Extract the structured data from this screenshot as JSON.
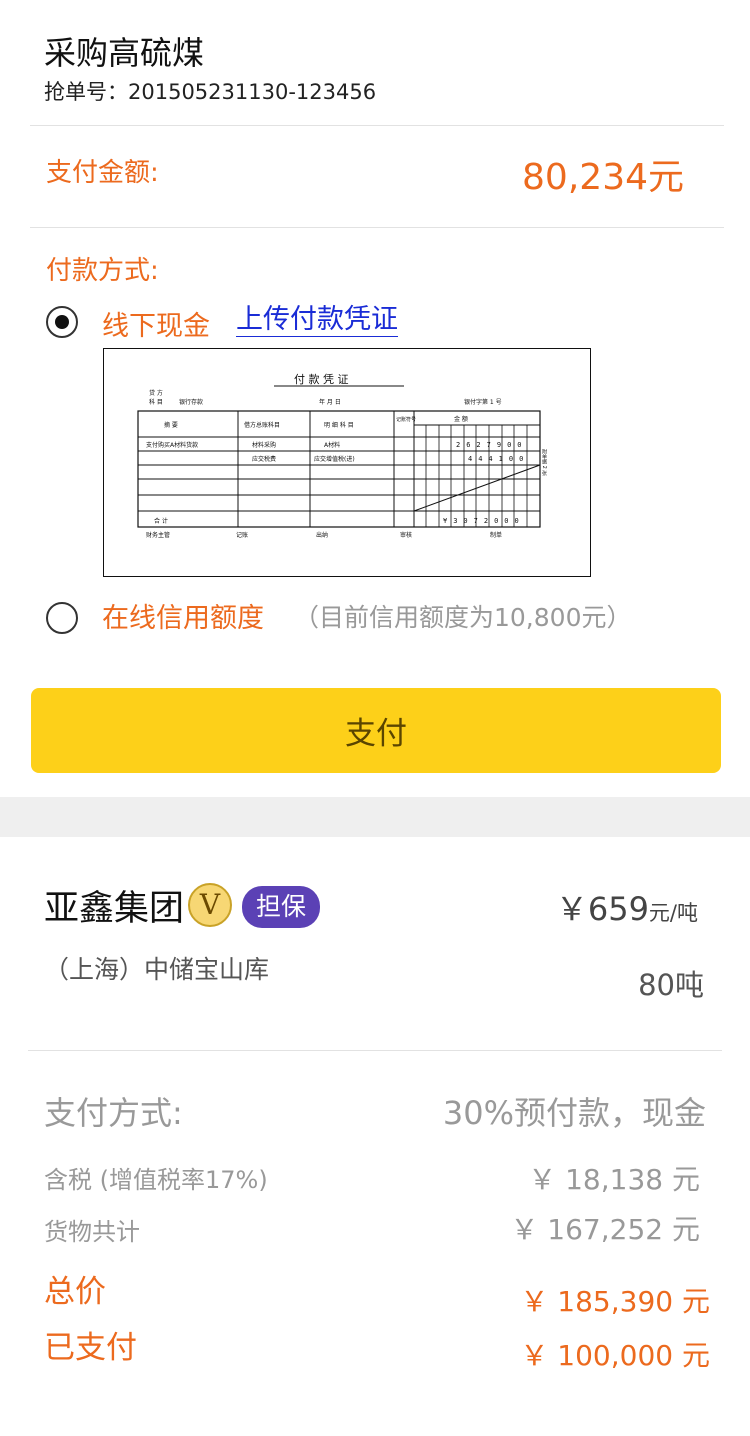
{
  "order": {
    "title": "采购高硫煤",
    "number_label": "抢单号：",
    "number_value": "201505231130-123456"
  },
  "payment": {
    "amount_label": "支付金额:",
    "amount_value": "80,234元",
    "method_label": "付款方式:",
    "options": [
      {
        "label": "线下现金",
        "selected": true,
        "link": "上传付款凭证"
      },
      {
        "label": "在线信用额度",
        "selected": false,
        "note": "（目前信用额度为10,800元）"
      }
    ],
    "pay_button": "支付"
  },
  "voucher": {
    "title": "付 款 凭 证",
    "top_left_1": "贷 方",
    "top_left_2": "科 目",
    "account": "银行存款",
    "date": "年  月  日",
    "voucher_no": "银付字第 1 号",
    "headers": [
      "摘  要",
      "借方总账科目",
      "明 细 科 目",
      "记账符号",
      "金   额"
    ],
    "digit_headers": [
      "千",
      "百",
      "十",
      "万",
      "千",
      "百",
      "十",
      "元",
      "角",
      "分"
    ],
    "rows": [
      {
        "summary": "支付购买A材料货款",
        "account": "材料采购",
        "detail": "A材料",
        "digits": "2627900"
      },
      {
        "summary": "",
        "account": "应交税费",
        "detail": "应交增值税(进)",
        "digits": "444100"
      }
    ],
    "total_label": "合      计",
    "total_digits": "¥3072000",
    "side_note": "附单据 2 张",
    "footer": [
      "财务主管",
      "记账",
      "出纳",
      "审核",
      "制单"
    ]
  },
  "seller": {
    "company": "亚鑫集团",
    "vip_badge": "V",
    "guarantee_badge": "担保",
    "price_symbol": "￥",
    "price_value": "659",
    "price_unit": "元/吨",
    "location": "（上海）中储宝山库",
    "quantity": "80吨"
  },
  "summary": {
    "pay_method_label": "支付方式:",
    "pay_method_value": "30%预付款，现金",
    "tax_label": "含税 (增值税率17%)",
    "tax_value": "￥ 18,138 元",
    "goods_label": "货物共计",
    "goods_value": "￥ 167,252 元",
    "total_label": "总价",
    "total_value": "￥ 185,390 元",
    "paid_label": "已支付",
    "paid_value": "￥ 100,000 元"
  },
  "colors": {
    "accent": "#ec6a1e",
    "button": "#fdd019",
    "link": "#1a2cd6",
    "badge_purple": "#5b41b5"
  }
}
